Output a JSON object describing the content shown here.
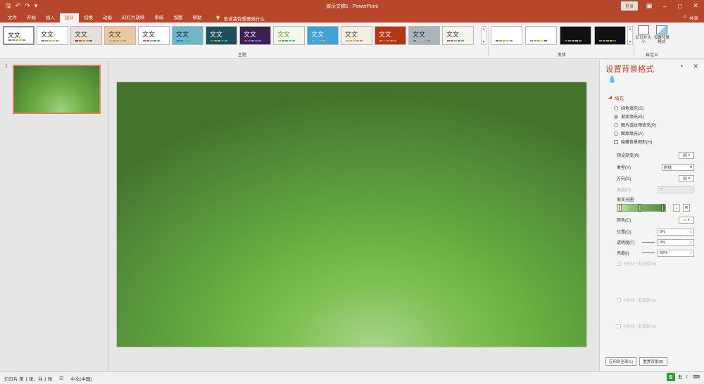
{
  "titlebar": {
    "doc_title": "演示文稿1  -  PowerPoint",
    "login_label": "登录",
    "qat": [
      "save-icon",
      "undo-icon",
      "redo-icon",
      "customize-icon"
    ],
    "window_controls": [
      "ribbon-display-icon",
      "minimize-icon",
      "restore-icon",
      "close-icon"
    ]
  },
  "tabs": {
    "items": [
      "文件",
      "开始",
      "插入",
      "设计",
      "切换",
      "动画",
      "幻灯片放映",
      "审阅",
      "视图",
      "帮助"
    ],
    "active": "设计",
    "tell_me": "告诉我你想要做什么",
    "share": "共享"
  },
  "ribbon": {
    "themes_label": "主题",
    "variants_label": "变体",
    "customize_label": "自定义",
    "theme_text": "文文",
    "themes": [
      {
        "bg": "#ffffff",
        "fg": "#222222",
        "bars": [
          "#4472c4",
          "#ed7d31",
          "#a5a5a5",
          "#ffc000",
          "#5b9bd5"
        ]
      },
      {
        "bg": "#ffffff",
        "fg": "#222222",
        "bars": [
          "#4472c4",
          "#ed7d31",
          "#a5a5a5",
          "#ffc000",
          "#5b9bd5"
        ]
      },
      {
        "bg": "#e6e0dc",
        "fg": "#333333",
        "bars": [
          "#a5300f",
          "#d55816",
          "#e19825",
          "#b19c7d",
          "#7f5f52"
        ]
      },
      {
        "bg": "#e8c9a0",
        "fg": "#333333",
        "bars": [
          "#94b6d2",
          "#dd8047",
          "#a5ab81",
          "#d8b25c",
          "#7ba79d"
        ]
      },
      {
        "bg": "#ffffff",
        "fg": "#222222",
        "bars": [
          "#4f81bd",
          "#c0504d",
          "#9bbb59",
          "#8064a2",
          "#4bacc6"
        ]
      },
      {
        "bg": "#6fb7c8",
        "fg": "#111111",
        "bars": [
          "#0f6fc6",
          "#009dd9",
          "#0bd0d9",
          "#10cf9b",
          "#7cca62"
        ]
      },
      {
        "bg": "#1e4d5c",
        "fg": "#ffffff",
        "bars": [
          "#549e39",
          "#8ab833",
          "#c0cf3a",
          "#029676",
          "#4ab5c4"
        ]
      },
      {
        "bg": "#3b2153",
        "fg": "#ffffff",
        "bars": [
          "#e32d91",
          "#c830cc",
          "#4ea6dc",
          "#4775e7",
          "#8971e1"
        ]
      },
      {
        "bg": "#f3f7ea",
        "fg": "#5a9a2c",
        "bars": [
          "#99cb38",
          "#63a537",
          "#37a76f",
          "#44c1a3",
          "#4eb3cf"
        ]
      },
      {
        "bg": "#3ea3d8",
        "fg": "#ffffff",
        "bars": [
          "#5fb7ee",
          "#46b2b5",
          "#8cc168",
          "#f4a23d",
          "#e56b5d"
        ]
      },
      {
        "bg": "#f2efe2",
        "fg": "#333333",
        "bars": [
          "#a5b592",
          "#f3a447",
          "#e7bc29",
          "#d092a7",
          "#9c85c0"
        ]
      },
      {
        "bg": "#b53411",
        "fg": "#ffffff",
        "bars": [
          "#f0a22e",
          "#a5644e",
          "#b58b80",
          "#c3986d",
          "#a19574"
        ]
      },
      {
        "bg": "#a9b4bb",
        "fg": "#222222",
        "bars": [
          "#6f6f74",
          "#a7b789",
          "#beae98",
          "#92a9b9",
          "#9c8265"
        ]
      },
      {
        "bg": "#f7f4ee",
        "fg": "#222222",
        "bars": [
          "#4f81bd",
          "#c0504d",
          "#9bbb59",
          "#8064a2",
          "#4bacc6"
        ]
      }
    ],
    "variants": [
      {
        "bg": "#ffffff",
        "bars": [
          "#4472c4",
          "#ed7d31",
          "#a5a5a5",
          "#ffc000",
          "#5b9bd5"
        ]
      },
      {
        "bg": "#ffffff",
        "bars": [
          "#5b9bd5",
          "#ed7d31",
          "#a5a5a5",
          "#ffc000",
          "#4472c4"
        ]
      },
      {
        "bg": "#111111",
        "bars": [
          "#4472c4",
          "#ed7d31",
          "#a5a5a5",
          "#ffc000",
          "#5b9bd5"
        ]
      },
      {
        "bg": "#111111",
        "bars": [
          "#5b9bd5",
          "#ed7d31",
          "#a5a5a5",
          "#ffc000",
          "#4472c4"
        ]
      }
    ],
    "slide_size": "幻灯片大小",
    "format_bg": "设置背景格式"
  },
  "thumbnail": {
    "number": "1"
  },
  "format_pane": {
    "title": "设置背景格式",
    "section": "填充",
    "options": [
      {
        "label": "纯色填充(S)",
        "type": "radio",
        "on": false
      },
      {
        "label": "渐变填充(G)",
        "type": "radio",
        "on": true
      },
      {
        "label": "图片或纹理填充(P)",
        "type": "radio",
        "on": false
      },
      {
        "label": "图案填充(A)",
        "type": "radio",
        "on": false
      },
      {
        "label": "隐藏背景图形(H)",
        "type": "check",
        "on": false
      }
    ],
    "preset_label": "预设渐变(R)",
    "type_label": "类型(Y)",
    "type_value": "射线",
    "direction_label": "方向(D)",
    "angle_label": "角度(E)",
    "angle_value": "0°",
    "stops_label": "渐变光圈",
    "color_label": "颜色(C)",
    "position_label": "位置(O)",
    "position_value": "0%",
    "transparency_label": "透明度(T)",
    "transparency_value": "0%",
    "brightness_label": "亮度(I)",
    "brightness_value": "60%",
    "rotate_label": "与形状一起旋转(W)",
    "dim1": "与形状一起旋转(W)",
    "dim2": "与形状一起旋转(W)",
    "reset_btn": "重置背景(B)",
    "apply_all_btn": "应用到全部(L)"
  },
  "status": {
    "slide_info": "幻灯片 第 1 张，共 1 张",
    "language": "中文(中国)",
    "ime_label": "S",
    "ime_text": "五"
  },
  "colors": {
    "accent": "#b7472a",
    "slide_dark": "#44742c",
    "slide_light": "#a8d58d"
  }
}
